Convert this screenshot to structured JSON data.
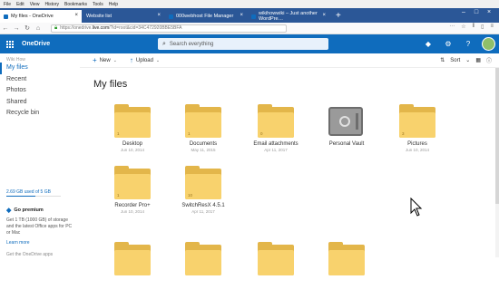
{
  "menubar": [
    "File",
    "Edit",
    "View",
    "History",
    "Bookmarks",
    "Tools",
    "Help"
  ],
  "tabs": [
    {
      "label": "My files - OneDrive",
      "active": true
    },
    {
      "label": "Website list",
      "active": false
    },
    {
      "label": "000webhost File Manager",
      "active": false
    },
    {
      "label": "wikihowwiki – Just another WordPre…",
      "active": false
    }
  ],
  "address": {
    "prefix": "https://onedrive.",
    "host": "live.com",
    "path": "/?id=root&cid=34C472920BBE5BFA"
  },
  "header": {
    "brand": "OneDrive",
    "search_placeholder": "Search everything"
  },
  "sidebar": {
    "user": "Wiki How",
    "items": [
      {
        "label": "My files",
        "active": true
      },
      {
        "label": "Recent",
        "active": false
      },
      {
        "label": "Photos",
        "active": false
      },
      {
        "label": "Shared",
        "active": false
      },
      {
        "label": "Recycle bin",
        "active": false
      }
    ],
    "storage": "2.69 GB used of 5 GB",
    "storage_fraction": 0.54,
    "premium_title": "Go premium",
    "premium_text": "Get 1 TB (1000 GB) of storage and the latest Office apps for PC or Mac",
    "learn_more": "Learn more",
    "get_apps": "Get the OneDrive apps"
  },
  "commands": {
    "new": "New",
    "upload": "Upload",
    "sort": "Sort"
  },
  "page_title": "My files",
  "folders": [
    {
      "name": "Desktop",
      "date": "Jun 10, 2014",
      "count": "1",
      "type": "folder"
    },
    {
      "name": "Documents",
      "date": "May 11, 2015",
      "count": "1",
      "type": "folder"
    },
    {
      "name": "Email attachments",
      "date": "Apr 11, 2017",
      "count": "0",
      "type": "folder"
    },
    {
      "name": "Personal Vault",
      "date": "",
      "count": "",
      "type": "vault"
    },
    {
      "name": "Pictures",
      "date": "Jun 10, 2014",
      "count": "3",
      "type": "folder"
    },
    {
      "name": "Recorder Pro+",
      "date": "Jun 10, 2014",
      "count": "1",
      "type": "folder"
    },
    {
      "name": "SwitchResX 4.5.1",
      "date": "Apr 11, 2017",
      "count": "10",
      "type": "folder"
    }
  ],
  "colors": {
    "brand": "#0f6cbd",
    "tabbar": "#2b5797",
    "folder_back": "#e3b64a",
    "folder_front": "#f8d26d"
  }
}
